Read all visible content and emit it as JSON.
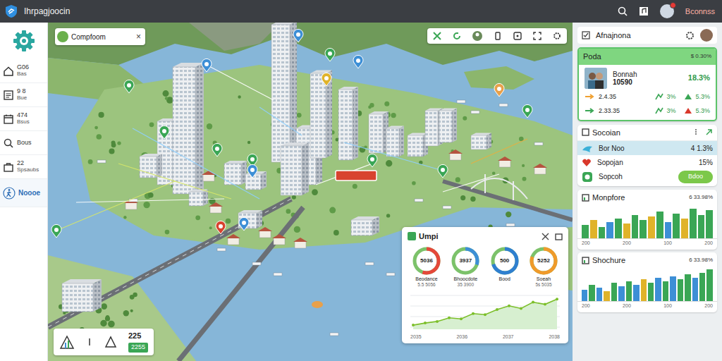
{
  "window": {
    "title": "Ihrpagjoocin"
  },
  "topbar": {
    "user": "Bconnss",
    "notifications": {
      "unread": true
    }
  },
  "sidebar": {
    "items": [
      {
        "label": "G06",
        "sub": "Bas",
        "selected": false
      },
      {
        "label": "9 8",
        "sub": "Bue",
        "selected": false
      },
      {
        "label": "474",
        "sub": "Bsus",
        "selected": false
      },
      {
        "label": "Bous",
        "selected": false
      },
      {
        "label": "22",
        "sub": "Spsaubs",
        "selected": false
      },
      {
        "label": "Noooe",
        "selected": true
      }
    ]
  },
  "map": {
    "search": {
      "text": "Compfoom",
      "close": "×"
    },
    "mini_card": {
      "value": "225",
      "badge": "2255"
    }
  },
  "stats_card": {
    "title": "Umpi",
    "donuts": [
      {
        "value": "5036",
        "label": "Beodance",
        "sub": "5.5 5056",
        "level": 0.55,
        "color": "#e5483a"
      },
      {
        "value": "3937",
        "label": "Bhoocdote",
        "sub": "35 3900",
        "level": 0.3,
        "color": "#3d8fd6"
      },
      {
        "value": "500",
        "label": "Bood",
        "level": 0.7,
        "color": "#2f7fd0"
      },
      {
        "value": "5252",
        "label": "Soeah",
        "sub": "5s 5035",
        "level": 0.8,
        "color": "#f09a2a"
      }
    ],
    "line": {
      "values": [
        8,
        12,
        15,
        22,
        20,
        30,
        28,
        38,
        45,
        40,
        52,
        48,
        58
      ],
      "ticks": [
        "2035",
        "2036",
        "2037",
        "2038"
      ]
    }
  },
  "panel": {
    "title": "Afnajnona",
    "poda": {
      "title": "Poda",
      "reading": "$ 0.30%",
      "main": {
        "name": "Bonnah",
        "value": "10590",
        "change": "18.3%"
      },
      "rows": [
        {
          "value": "2.4.35",
          "a": "3%",
          "b": "5.3%"
        },
        {
          "value": "2.33.35",
          "a": "3%",
          "b": "5.3%"
        }
      ]
    },
    "social": {
      "title": "Socoian",
      "rows": [
        {
          "label": "Bor Noo",
          "value": "4 1.3%",
          "selected": true
        },
        {
          "label": "Sopojan",
          "value": "15%",
          "selected": false
        }
      ],
      "action": {
        "label": "Sopcoh",
        "button": "Bdoo"
      }
    },
    "charts": [
      {
        "title": "Monpfore",
        "reading": "6 33.98%",
        "bars": [
          {
            "value": 40,
            "color": "#3aa655"
          },
          {
            "value": 55,
            "color": "#e0b32a"
          },
          {
            "value": 35,
            "color": "#3aa655"
          },
          {
            "value": 50,
            "color": "#3d8fd6"
          },
          {
            "value": 60,
            "color": "#3aa655"
          },
          {
            "value": 45,
            "color": "#e0b32a"
          },
          {
            "value": 70,
            "color": "#3aa655"
          },
          {
            "value": 55,
            "color": "#3aa655"
          },
          {
            "value": 65,
            "color": "#e0b32a"
          },
          {
            "value": 80,
            "color": "#3aa655"
          },
          {
            "value": 50,
            "color": "#3d8fd6"
          },
          {
            "value": 75,
            "color": "#3aa655"
          },
          {
            "value": 60,
            "color": "#e0b32a"
          },
          {
            "value": 90,
            "color": "#3aa655"
          },
          {
            "value": 70,
            "color": "#3aa655"
          },
          {
            "value": 85,
            "color": "#3aa655"
          }
        ],
        "ticks": [
          "200",
          "200",
          "100",
          "200"
        ]
      },
      {
        "title": "Shochure",
        "reading": "6 33.98%",
        "bars": [
          {
            "value": 35,
            "color": "#3d8fd6"
          },
          {
            "value": 50,
            "color": "#3aa655"
          },
          {
            "value": 40,
            "color": "#3d8fd6"
          },
          {
            "value": 30,
            "color": "#e0b32a"
          },
          {
            "value": 55,
            "color": "#3aa655"
          },
          {
            "value": 45,
            "color": "#3d8fd6"
          },
          {
            "value": 60,
            "color": "#3aa655"
          },
          {
            "value": 50,
            "color": "#3d8fd6"
          },
          {
            "value": 65,
            "color": "#e0b32a"
          },
          {
            "value": 55,
            "color": "#3aa655"
          },
          {
            "value": 70,
            "color": "#3d8fd6"
          },
          {
            "value": 60,
            "color": "#3aa655"
          },
          {
            "value": 75,
            "color": "#3d8fd6"
          },
          {
            "value": 65,
            "color": "#3aa655"
          },
          {
            "value": 80,
            "color": "#3aa655"
          },
          {
            "value": 70,
            "color": "#3d8fd6"
          },
          {
            "value": 85,
            "color": "#3aa655"
          },
          {
            "value": 95,
            "color": "#3aa655"
          }
        ],
        "ticks": [
          "200",
          "200",
          "100",
          "200"
        ]
      }
    ]
  }
}
